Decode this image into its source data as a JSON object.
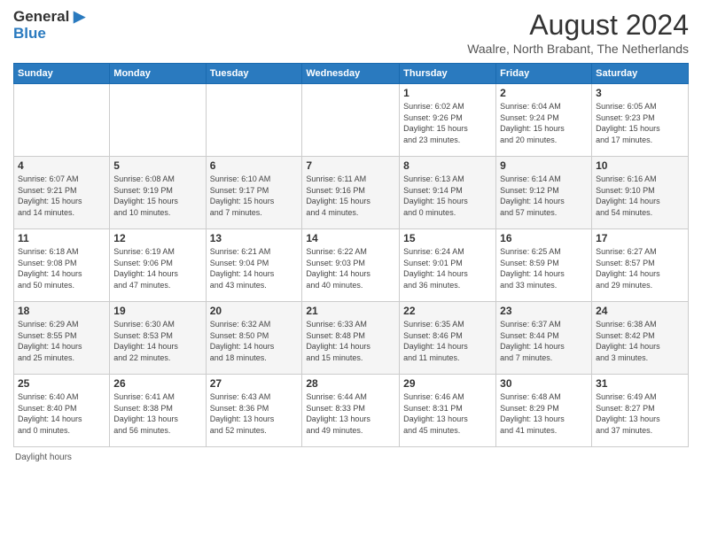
{
  "header": {
    "logo_general": "General",
    "logo_blue": "Blue",
    "main_title": "August 2024",
    "subtitle": "Waalre, North Brabant, The Netherlands"
  },
  "days_of_week": [
    "Sunday",
    "Monday",
    "Tuesday",
    "Wednesday",
    "Thursday",
    "Friday",
    "Saturday"
  ],
  "weeks": [
    [
      {
        "day": "",
        "info": ""
      },
      {
        "day": "",
        "info": ""
      },
      {
        "day": "",
        "info": ""
      },
      {
        "day": "",
        "info": ""
      },
      {
        "day": "1",
        "info": "Sunrise: 6:02 AM\nSunset: 9:26 PM\nDaylight: 15 hours\nand 23 minutes."
      },
      {
        "day": "2",
        "info": "Sunrise: 6:04 AM\nSunset: 9:24 PM\nDaylight: 15 hours\nand 20 minutes."
      },
      {
        "day": "3",
        "info": "Sunrise: 6:05 AM\nSunset: 9:23 PM\nDaylight: 15 hours\nand 17 minutes."
      }
    ],
    [
      {
        "day": "4",
        "info": "Sunrise: 6:07 AM\nSunset: 9:21 PM\nDaylight: 15 hours\nand 14 minutes."
      },
      {
        "day": "5",
        "info": "Sunrise: 6:08 AM\nSunset: 9:19 PM\nDaylight: 15 hours\nand 10 minutes."
      },
      {
        "day": "6",
        "info": "Sunrise: 6:10 AM\nSunset: 9:17 PM\nDaylight: 15 hours\nand 7 minutes."
      },
      {
        "day": "7",
        "info": "Sunrise: 6:11 AM\nSunset: 9:16 PM\nDaylight: 15 hours\nand 4 minutes."
      },
      {
        "day": "8",
        "info": "Sunrise: 6:13 AM\nSunset: 9:14 PM\nDaylight: 15 hours\nand 0 minutes."
      },
      {
        "day": "9",
        "info": "Sunrise: 6:14 AM\nSunset: 9:12 PM\nDaylight: 14 hours\nand 57 minutes."
      },
      {
        "day": "10",
        "info": "Sunrise: 6:16 AM\nSunset: 9:10 PM\nDaylight: 14 hours\nand 54 minutes."
      }
    ],
    [
      {
        "day": "11",
        "info": "Sunrise: 6:18 AM\nSunset: 9:08 PM\nDaylight: 14 hours\nand 50 minutes."
      },
      {
        "day": "12",
        "info": "Sunrise: 6:19 AM\nSunset: 9:06 PM\nDaylight: 14 hours\nand 47 minutes."
      },
      {
        "day": "13",
        "info": "Sunrise: 6:21 AM\nSunset: 9:04 PM\nDaylight: 14 hours\nand 43 minutes."
      },
      {
        "day": "14",
        "info": "Sunrise: 6:22 AM\nSunset: 9:03 PM\nDaylight: 14 hours\nand 40 minutes."
      },
      {
        "day": "15",
        "info": "Sunrise: 6:24 AM\nSunset: 9:01 PM\nDaylight: 14 hours\nand 36 minutes."
      },
      {
        "day": "16",
        "info": "Sunrise: 6:25 AM\nSunset: 8:59 PM\nDaylight: 14 hours\nand 33 minutes."
      },
      {
        "day": "17",
        "info": "Sunrise: 6:27 AM\nSunset: 8:57 PM\nDaylight: 14 hours\nand 29 minutes."
      }
    ],
    [
      {
        "day": "18",
        "info": "Sunrise: 6:29 AM\nSunset: 8:55 PM\nDaylight: 14 hours\nand 25 minutes."
      },
      {
        "day": "19",
        "info": "Sunrise: 6:30 AM\nSunset: 8:53 PM\nDaylight: 14 hours\nand 22 minutes."
      },
      {
        "day": "20",
        "info": "Sunrise: 6:32 AM\nSunset: 8:50 PM\nDaylight: 14 hours\nand 18 minutes."
      },
      {
        "day": "21",
        "info": "Sunrise: 6:33 AM\nSunset: 8:48 PM\nDaylight: 14 hours\nand 15 minutes."
      },
      {
        "day": "22",
        "info": "Sunrise: 6:35 AM\nSunset: 8:46 PM\nDaylight: 14 hours\nand 11 minutes."
      },
      {
        "day": "23",
        "info": "Sunrise: 6:37 AM\nSunset: 8:44 PM\nDaylight: 14 hours\nand 7 minutes."
      },
      {
        "day": "24",
        "info": "Sunrise: 6:38 AM\nSunset: 8:42 PM\nDaylight: 14 hours\nand 3 minutes."
      }
    ],
    [
      {
        "day": "25",
        "info": "Sunrise: 6:40 AM\nSunset: 8:40 PM\nDaylight: 14 hours\nand 0 minutes."
      },
      {
        "day": "26",
        "info": "Sunrise: 6:41 AM\nSunset: 8:38 PM\nDaylight: 13 hours\nand 56 minutes."
      },
      {
        "day": "27",
        "info": "Sunrise: 6:43 AM\nSunset: 8:36 PM\nDaylight: 13 hours\nand 52 minutes."
      },
      {
        "day": "28",
        "info": "Sunrise: 6:44 AM\nSunset: 8:33 PM\nDaylight: 13 hours\nand 49 minutes."
      },
      {
        "day": "29",
        "info": "Sunrise: 6:46 AM\nSunset: 8:31 PM\nDaylight: 13 hours\nand 45 minutes."
      },
      {
        "day": "30",
        "info": "Sunrise: 6:48 AM\nSunset: 8:29 PM\nDaylight: 13 hours\nand 41 minutes."
      },
      {
        "day": "31",
        "info": "Sunrise: 6:49 AM\nSunset: 8:27 PM\nDaylight: 13 hours\nand 37 minutes."
      }
    ]
  ],
  "footer": {
    "daylight_label": "Daylight hours"
  }
}
